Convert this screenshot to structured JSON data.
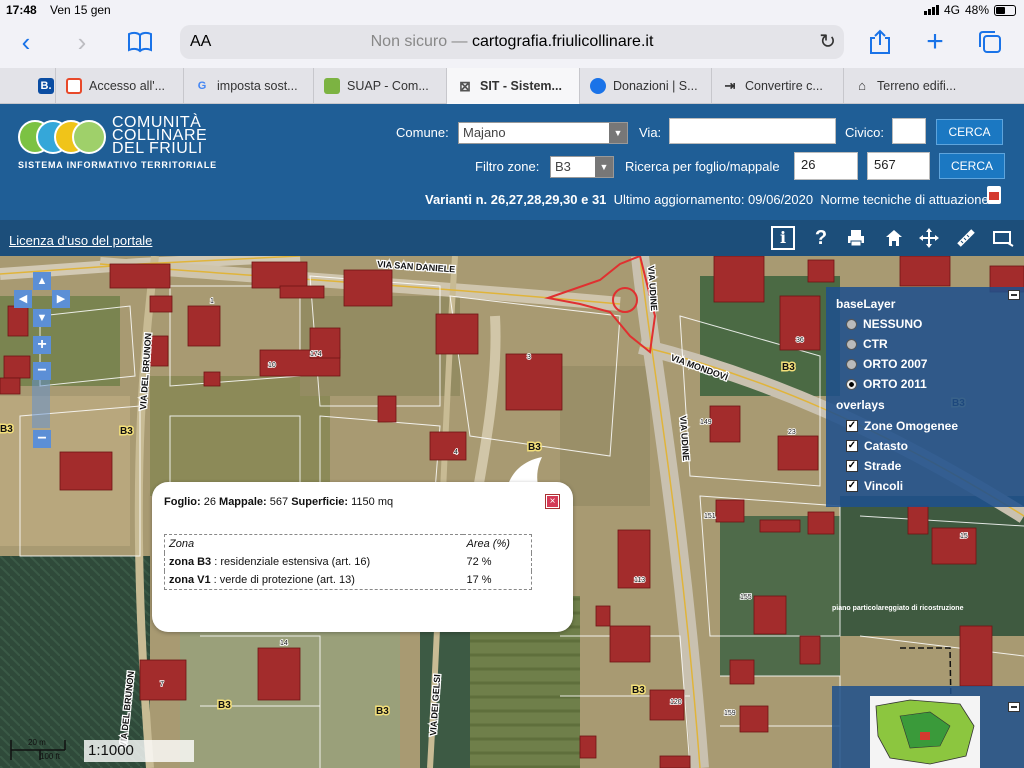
{
  "status_bar": {
    "time": "17:48",
    "date": "Ven 15 gen",
    "network": "4G",
    "battery": "48%"
  },
  "browser": {
    "text_size_label": "AA",
    "url_prefix": "Non sicuro — ",
    "url_domain": "cartografia.friulicollinare.it"
  },
  "tabs": [
    {
      "label": "Bo",
      "icon": "b-letter-icon",
      "color": "#0b4da2"
    },
    {
      "label": "Accesso all'...",
      "icon": "c-logo-icon",
      "color": "#e8492a"
    },
    {
      "label": "imposta sost...",
      "icon": "google-icon",
      "color": "#4285f4"
    },
    {
      "label": "SUAP - Com...",
      "icon": "suap-icon",
      "color": "#7cb342"
    },
    {
      "label": "SIT - Sistem...",
      "icon": "sit-icon",
      "color": "#555555"
    },
    {
      "label": "Donazioni | S...",
      "icon": "edge-icon",
      "color": "#1a73e8"
    },
    {
      "label": "Convertire c...",
      "icon": "convert-icon",
      "color": "#333333"
    },
    {
      "label": "Terreno edifi...",
      "icon": "house-icon",
      "color": "#333333"
    }
  ],
  "portal": {
    "logo_line1": "COMUNITÀ",
    "logo_line2": "COLLINARE",
    "logo_line3": "DEL FRIULI",
    "logo_subtitle": "SISTEMA INFORMATIVO TERRITORIALE",
    "comune_label": "Comune:",
    "comune_value": "Majano",
    "via_label": "Via:",
    "via_value": "",
    "civico_label": "Civico:",
    "civico_value": "",
    "cerca_label": "CERCA",
    "filtro_label": "Filtro zone:",
    "filtro_value": "B3",
    "ricerca_label": "Ricerca per foglio/mappale",
    "foglio_value": "26",
    "mappale_value": "567",
    "varianti": "Varianti n. 26,27,28,29,30 e 31",
    "aggiornamento": "Ultimo aggiornamento: 09/06/2020",
    "norme": "Norme tecniche di attuazione"
  },
  "licenza": "Licenza d'uso del portale",
  "map": {
    "streets": [
      "VIA SAN DANIELE",
      "VIA UDINE",
      "VIA MONDOVÌ",
      "VIA DEL BRUNON",
      "VIA DEI GELSI"
    ],
    "zone_labels": [
      "B3",
      "B3",
      "B3",
      "B3",
      "B3",
      "B3",
      "B3",
      "B3"
    ],
    "parcel_numbers": [
      "1",
      "10",
      "174",
      "3",
      "4",
      "36",
      "149",
      "151",
      "113",
      "155",
      "14",
      "7",
      "120",
      "159",
      "15",
      "23"
    ],
    "annotation": "piano particolareggiato di ricostruzione",
    "scale_text": "1:1000",
    "scale_m": "20 m",
    "scale_ft": "100 ft"
  },
  "layers": {
    "base_title": "baseLayer",
    "base_options": [
      {
        "label": "NESSUNO",
        "selected": false
      },
      {
        "label": "CTR",
        "selected": false
      },
      {
        "label": "ORTO 2007",
        "selected": false
      },
      {
        "label": "ORTO 2011",
        "selected": true
      }
    ],
    "overlay_title": "overlays",
    "overlay_options": [
      {
        "label": "Zone Omogenee",
        "checked": true
      },
      {
        "label": "Catasto",
        "checked": true
      },
      {
        "label": "Strade",
        "checked": true
      },
      {
        "label": "Vincoli",
        "checked": true
      }
    ]
  },
  "popup": {
    "foglio_label": "Foglio:",
    "foglio": "26",
    "mappale_label": "Mappale:",
    "mappale": "567",
    "superficie_label": "Superficie:",
    "superficie": "1150 mq",
    "col_zona": "Zona",
    "col_area": "Area (%)",
    "rows": [
      {
        "zona": "zona B3",
        "desc": " : residenziale estensiva (art. 16)",
        "area": "72 %"
      },
      {
        "zona": "zona V1",
        "desc": " : verde di protezione (art. 13)",
        "area": "17 %"
      }
    ],
    "close_glyph": "×"
  },
  "colors": {
    "header": "#1f5e96",
    "toolbar": "#1c4e7a",
    "building": "#a32c2c",
    "accent": "#1b78c2"
  }
}
